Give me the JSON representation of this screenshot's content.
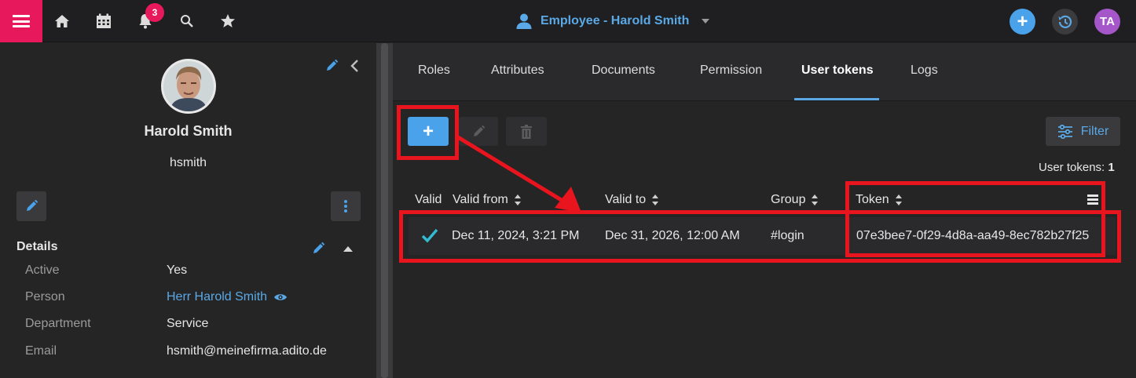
{
  "topbar": {
    "notification_count": "3",
    "title": "Employee - Harold Smith",
    "avatar_initials": "TA",
    "add_label": "+",
    "colors": {
      "menu": "#e8185c",
      "accent": "#5aa9e6",
      "avatar": "#a557c9"
    }
  },
  "profile": {
    "name": "Harold Smith",
    "login": "hsmith"
  },
  "details": {
    "heading": "Details",
    "rows": [
      {
        "label": "Active",
        "value": "Yes"
      },
      {
        "label": "Person",
        "value": "Herr Harold Smith"
      },
      {
        "label": "Department",
        "value": "Service"
      },
      {
        "label": "Email",
        "value": "hsmith@meinefirma.adito.de"
      }
    ]
  },
  "tabs": [
    {
      "label": "Roles"
    },
    {
      "label": "Attributes"
    },
    {
      "label": "Documents"
    },
    {
      "label": "Permission"
    },
    {
      "label": "User tokens",
      "active": true
    },
    {
      "label": "Logs"
    }
  ],
  "toolbar": {
    "add_label": "+",
    "filter_label": "Filter"
  },
  "table": {
    "count_label": "User tokens:",
    "count_value": "1",
    "columns": [
      "Valid",
      "Valid from",
      "Valid to",
      "Group",
      "Token"
    ],
    "rows": [
      {
        "valid": "check",
        "valid_from": "Dec 11, 2024, 3:21 PM",
        "valid_to": "Dec 31, 2026, 12:00 AM",
        "group": "#login",
        "token": "07e3bee7-0f29-4d8a-aa49-8ec782b27f25"
      }
    ]
  },
  "annotations": {
    "color": "#e8141e"
  }
}
